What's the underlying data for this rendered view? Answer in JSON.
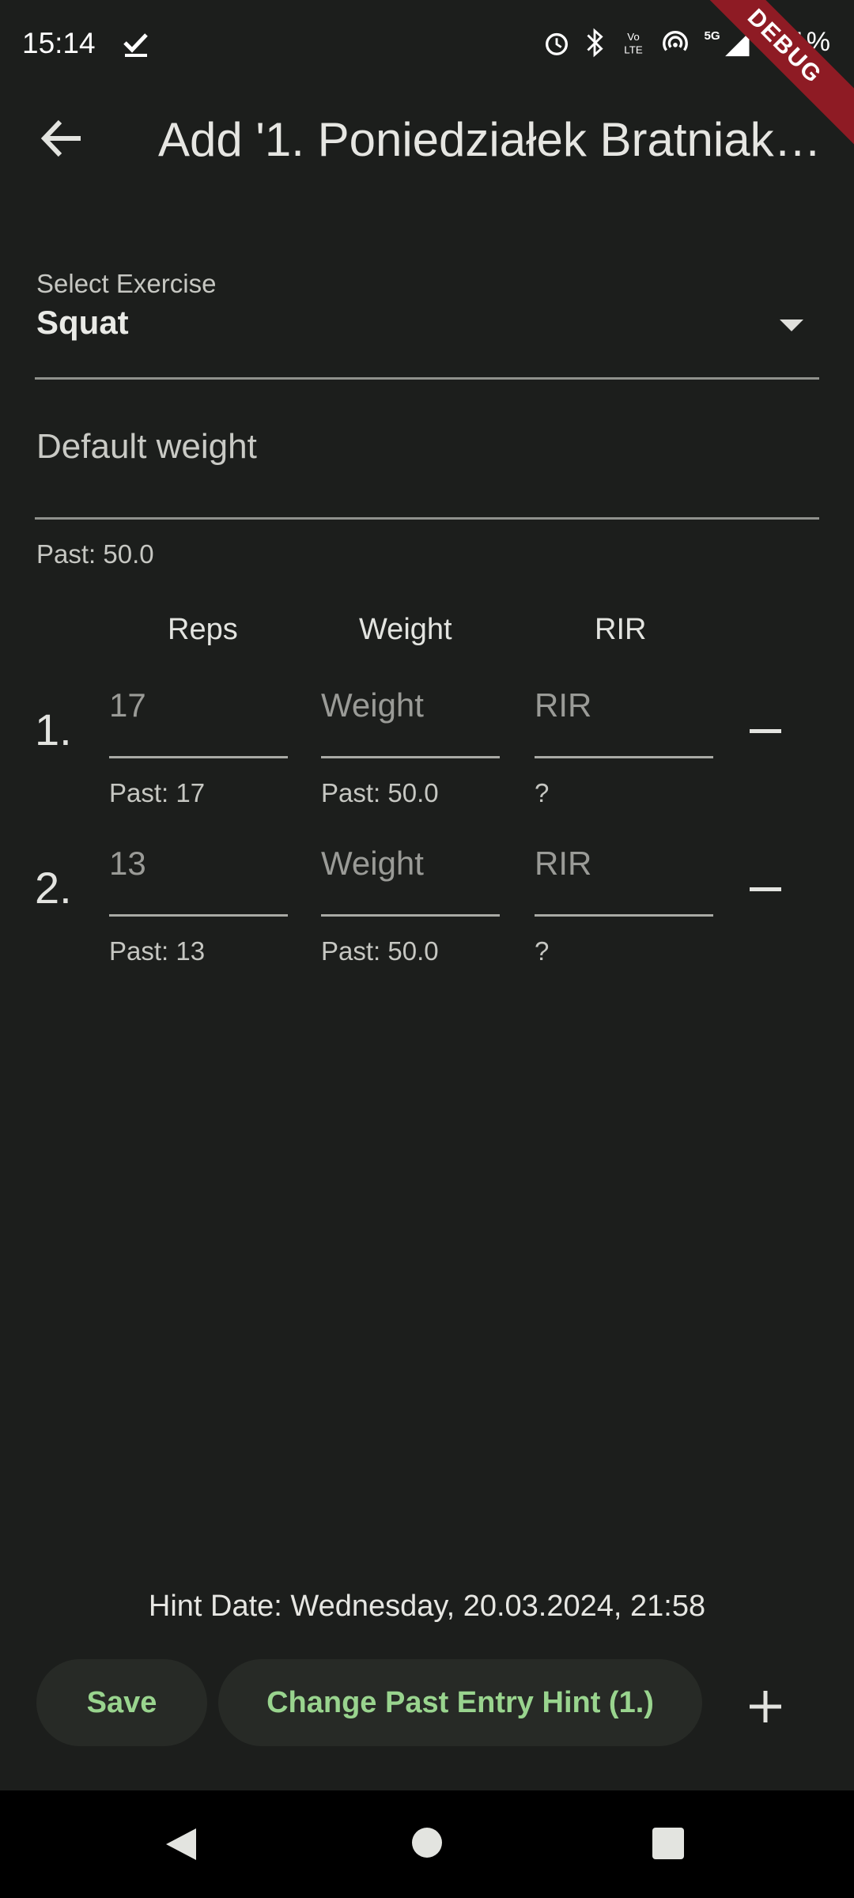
{
  "status_bar": {
    "time": "15:14",
    "battery_text": "1%"
  },
  "debug_banner": "DEBUG",
  "app_bar": {
    "title": "Add '1. Poniedziałek Bratniak…"
  },
  "exercise_select": {
    "label": "Select Exercise",
    "value": "Squat"
  },
  "default_weight": {
    "placeholder": "Default weight",
    "past": "Past: 50.0"
  },
  "columns": [
    "Reps",
    "Weight",
    "RIR"
  ],
  "sets": [
    {
      "number": "1.",
      "reps": "17",
      "weight": "Weight",
      "rir": "RIR",
      "reps_past": "Past: 17",
      "weight_past": "Past: 50.0",
      "rir_past": "?"
    },
    {
      "number": "2.",
      "reps": "13",
      "weight": "Weight",
      "rir": "RIR",
      "reps_past": "Past: 13",
      "weight_past": "Past: 50.0",
      "rir_past": "?"
    }
  ],
  "hint_date": "Hint Date: Wednesday, 20.03.2024, 21:58",
  "actions": {
    "save": "Save",
    "change_hint": "Change Past Entry Hint (1.)"
  },
  "colors": {
    "accent": "#99d48e",
    "background": "#1c1e1c",
    "debug": "#8e1b24"
  }
}
